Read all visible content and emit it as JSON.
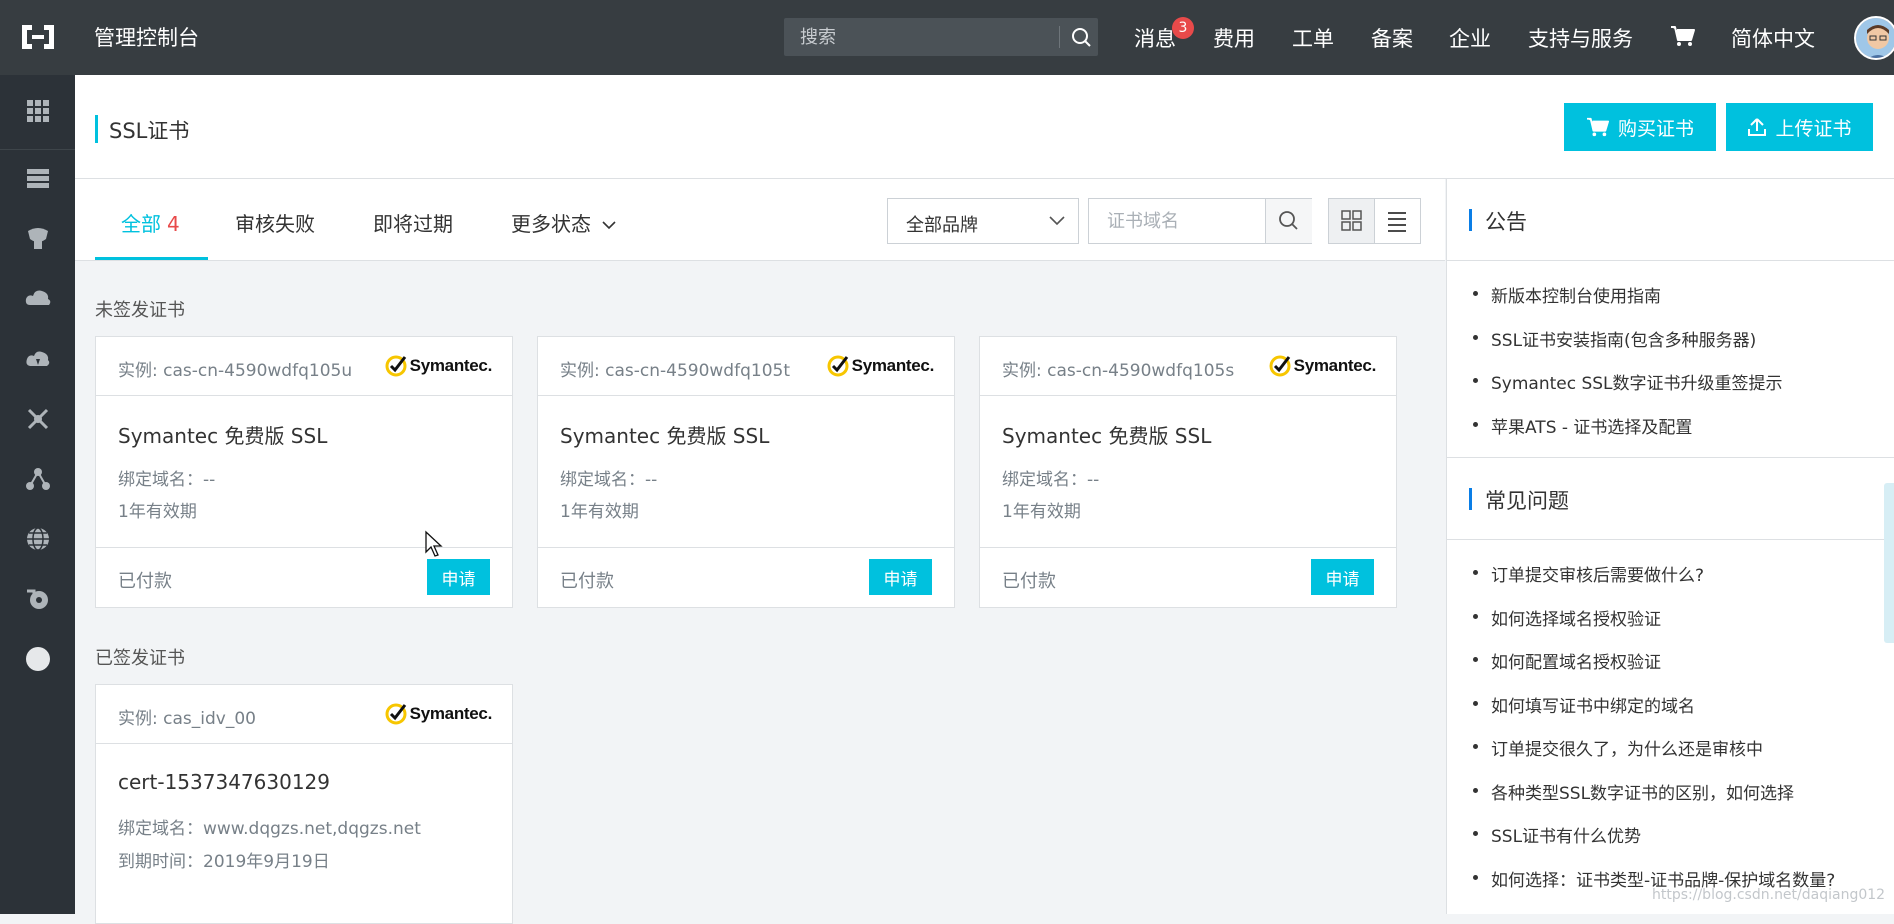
{
  "topbar": {
    "app_title": "管理控制台",
    "search_placeholder": "搜索",
    "nav": {
      "messages": "消息",
      "messages_badge": "3",
      "billing": "费用",
      "tickets": "工单",
      "icp": "备案",
      "enterprise": "企业",
      "support": "支持与服务",
      "language": "简体中文"
    }
  },
  "page": {
    "title": "SSL证书",
    "buy_button": "购买证书",
    "upload_button": "上传证书"
  },
  "filters": {
    "tabs": [
      {
        "label": "全部",
        "count": "4"
      },
      {
        "label": "审核失败"
      },
      {
        "label": "即将过期"
      },
      {
        "label": "更多状态"
      }
    ],
    "brand_select": "全部品牌",
    "domain_placeholder": "证书域名"
  },
  "unissued": {
    "section_label": "未签发证书",
    "cards": [
      {
        "instance": "实例: cas-cn-4590wdfq105u",
        "brand": "Symantec.",
        "title": "Symantec 免费版 SSL",
        "domain": "绑定域名：--",
        "validity": "1年有效期",
        "status": "已付款",
        "action": "申请"
      },
      {
        "instance": "实例: cas-cn-4590wdfq105t",
        "brand": "Symantec.",
        "title": "Symantec 免费版 SSL",
        "domain": "绑定域名：--",
        "validity": "1年有效期",
        "status": "已付款",
        "action": "申请"
      },
      {
        "instance": "实例: cas-cn-4590wdfq105s",
        "brand": "Symantec.",
        "title": "Symantec 免费版 SSL",
        "domain": "绑定域名：--",
        "validity": "1年有效期",
        "status": "已付款",
        "action": "申请"
      }
    ]
  },
  "issued": {
    "section_label": "已签发证书",
    "cards": [
      {
        "instance": "实例: cas_idv_00",
        "brand": "Symantec.",
        "title": "cert-1537347630129",
        "domain": "绑定域名：www.dqgzs.net,dqgzs.net",
        "expiry": "到期时间：2019年9月19日"
      }
    ]
  },
  "announcements": {
    "title": "公告",
    "items": [
      "新版本控制台使用指南",
      "SSL证书安装指南(包含多种服务器)",
      "Symantec SSL数字证书升级重签提示",
      "苹果ATS - 证书选择及配置"
    ]
  },
  "faq": {
    "title": "常见问题",
    "items": [
      "订单提交审核后需要做什么?",
      "如何选择域名授权验证",
      "如何配置域名授权验证",
      "如何填写证书中绑定的域名",
      "订单提交很久了，为什么还是审核中",
      "各种类型SSL数字证书的区别，如何选择",
      "SSL证书有什么优势",
      "如何选择：证书类型-证书品牌-保护域名数量?"
    ]
  },
  "watermark": "https://blog.csdn.net/daqiang012",
  "colors": {
    "topbar_bg": "#373d41",
    "sidebar_bg": "#2c3238",
    "accent": "#00c1de",
    "badge": "#e84a4a",
    "symantec_yellow": "#f7c600"
  }
}
